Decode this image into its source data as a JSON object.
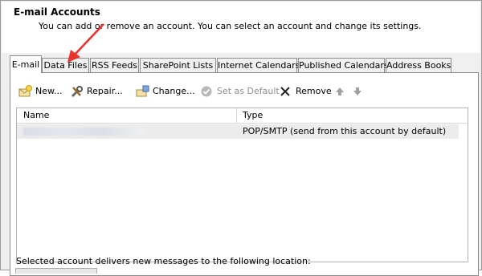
{
  "header": {
    "title": "E-mail Accounts",
    "subtitle": "You can add or remove an account. You can select an account and change its settings."
  },
  "tabs": [
    {
      "label": "E-mail",
      "active": true
    },
    {
      "label": "Data Files",
      "active": false
    },
    {
      "label": "RSS Feeds",
      "active": false
    },
    {
      "label": "SharePoint Lists",
      "active": false
    },
    {
      "label": "Internet Calendars",
      "active": false
    },
    {
      "label": "Published Calendars",
      "active": false
    },
    {
      "label": "Address Books",
      "active": false
    }
  ],
  "toolbar": {
    "new_label": "New...",
    "repair_label": "Repair...",
    "change_label": "Change...",
    "set_default_label": "Set as Default",
    "remove_label": "Remove"
  },
  "list": {
    "headers": {
      "name": "Name",
      "type": "Type"
    },
    "rows": [
      {
        "type": "POP/SMTP (send from this account by default)"
      }
    ]
  },
  "footer": {
    "delivery_text": "Selected account delivers new messages to the following location:"
  },
  "annotation": {
    "arrow_color": "#e8332f"
  }
}
